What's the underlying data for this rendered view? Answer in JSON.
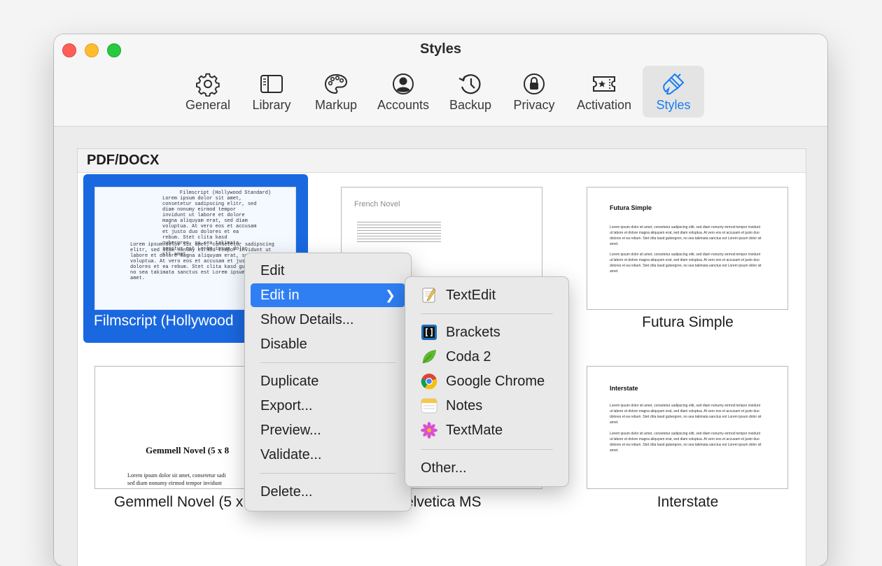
{
  "window": {
    "title": "Styles"
  },
  "toolbar": {
    "items": [
      {
        "label": "General",
        "icon": "gear-icon"
      },
      {
        "label": "Library",
        "icon": "library-icon"
      },
      {
        "label": "Markup",
        "icon": "palette-icon"
      },
      {
        "label": "Accounts",
        "icon": "account-icon"
      },
      {
        "label": "Backup",
        "icon": "backup-clock-icon"
      },
      {
        "label": "Privacy",
        "icon": "lock-icon"
      },
      {
        "label": "Activation",
        "icon": "ticket-star-icon"
      },
      {
        "label": "Styles",
        "icon": "paintbrush-icon",
        "active": true
      }
    ],
    "accent": "#1a7ef0"
  },
  "section": {
    "title": "PDF/DOCX"
  },
  "styles": [
    {
      "name": "Filmscript (Hollywood Standard)",
      "visible_name": "Filmscript (Hollywood",
      "selected": true,
      "preview_heading": "Filmscript (Hollywood Standard)",
      "preview_text_1": "Lorem ipsum dolor sit amet,\nconsetetur sadipscing elitr, sed\ndiam nonumy eirmod tempor\ninvidunt ut labore et dolore\nmagna aliquyam erat, sed diam\nvoluptua. At vero eos et accusam\net justo duo dolores et ea\nrebum. Stet clita kasd\ngubergren, no sea takimata\nsanctus est Lorem ipsum dolor\nsit amet.",
      "preview_text_2": "Lorem ipsum dolor sit amet, consetetur sadipscing\nelitr, sed diam nonumy eirmod tempor invidunt ut\nlabore et dolore magna aliquyam erat, sed diam\nvoluptua. At vero eos et accusam et justo duo\ndolores et ea rebum. Stet clita kasd gubergren,\nno sea takimata sanctus est Lorem ipsum dolor sit\namet."
    },
    {
      "name": "French Novel",
      "preview_heading": "French Novel"
    },
    {
      "name": "Futura Simple",
      "preview_heading": "Futura Simple",
      "preview_text_1": "Lorem ipsum dolor sit amet, consetetur sadipscing elitr, sed diam nonumy eirmod tempor invidunt ut labore et dolore magna aliquyam erat, sed diam voluptua. At vero eos et accusam et justo duo dolores et ea rebum. Stet clita kasd gubergren, no sea takimata sanctus est Lorem ipsum dolor sit amet.",
      "preview_text_2": "Lorem ipsum dolor sit amet, consetetur sadipscing elitr, sed diam nonumy eirmod tempor invidunt ut labore et dolore magna aliquyam erat, sed diam voluptua. At vero eos et accusam et justo duo dolores et ea rebum. Stet clita kasd gubergren, no sea takimata sanctus est Lorem ipsum dolor sit amet."
    },
    {
      "name": "Gemmell Novel (5 x 8)",
      "visible_name": "Gemmell Novel (5 x",
      "preview_heading": "Gemmell Novel (5 x 8",
      "preview_text_1": "Lorem ipsum dolor sit amet, consetetur sadi",
      "preview_text_2": "sed diam nonumy eirmod tempor invidunt"
    },
    {
      "name": "Helvetica MS",
      "visible_name": "elvetica MS"
    },
    {
      "name": "Interstate",
      "preview_heading": "Interstate",
      "preview_text_1": "Lorem ipsum dolor sit amet, consetetur sadipscing elitr, sed diam nonumy eirmod tempor invidunt ut labore et dolore magna aliquyam erat, sed diam voluptua. At vero eos et accusam et justo duo dolores et ea rebum. Stet clita kasd gubergren, no sea takimata sanctus est Lorem ipsum dolor sit amet.",
      "preview_text_2": "Lorem ipsum dolor sit amet, consetetur sadipscing elitr, sed diam nonumy eirmod tempor invidunt ut labore et dolore magna aliquyam erat, sed diam voluptua. At vero eos et accusam et justo duo dolores et ea rebum. Stet clita kasd gubergren, no sea takimata sanctus est Lorem ipsum dolor sit amet."
    }
  ],
  "context_menu": {
    "items": [
      {
        "label": "Edit"
      },
      {
        "label": "Edit in",
        "highlighted": true,
        "submenu": true
      },
      {
        "label": "Show Details..."
      },
      {
        "label": "Disable"
      },
      {
        "label": "Duplicate"
      },
      {
        "label": "Export..."
      },
      {
        "label": "Preview..."
      },
      {
        "label": "Validate..."
      },
      {
        "label": "Delete..."
      }
    ],
    "highlight_color": "#2f7ff3"
  },
  "submenu": {
    "items": [
      {
        "label": "TextEdit",
        "icon": "textedit-icon"
      },
      {
        "label": "Brackets",
        "icon": "brackets-icon"
      },
      {
        "label": "Coda 2",
        "icon": "coda-leaf-icon"
      },
      {
        "label": "Google Chrome",
        "icon": "chrome-icon"
      },
      {
        "label": "Notes",
        "icon": "notes-icon"
      },
      {
        "label": "TextMate",
        "icon": "textmate-flower-icon"
      },
      {
        "label": "Other..."
      }
    ]
  }
}
